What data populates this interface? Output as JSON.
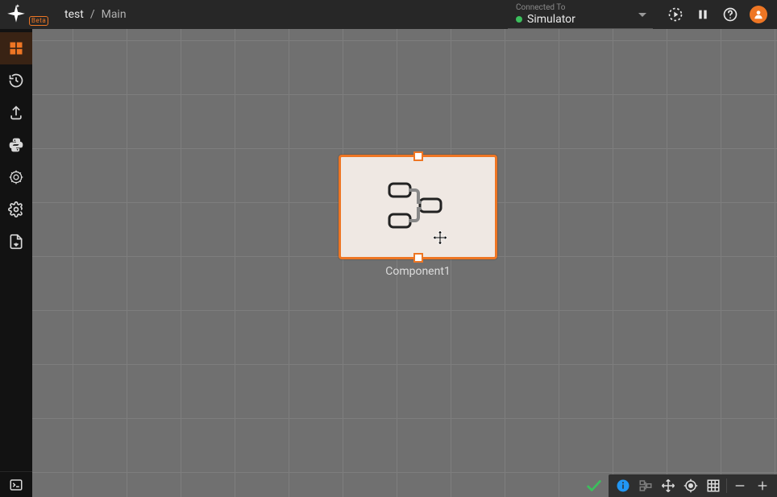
{
  "header": {
    "beta_label": "Beta",
    "project": "test",
    "separator": "/",
    "page": "Main"
  },
  "connection": {
    "sub": "Connected To",
    "target": "Simulator"
  },
  "node": {
    "label": "Component1"
  }
}
